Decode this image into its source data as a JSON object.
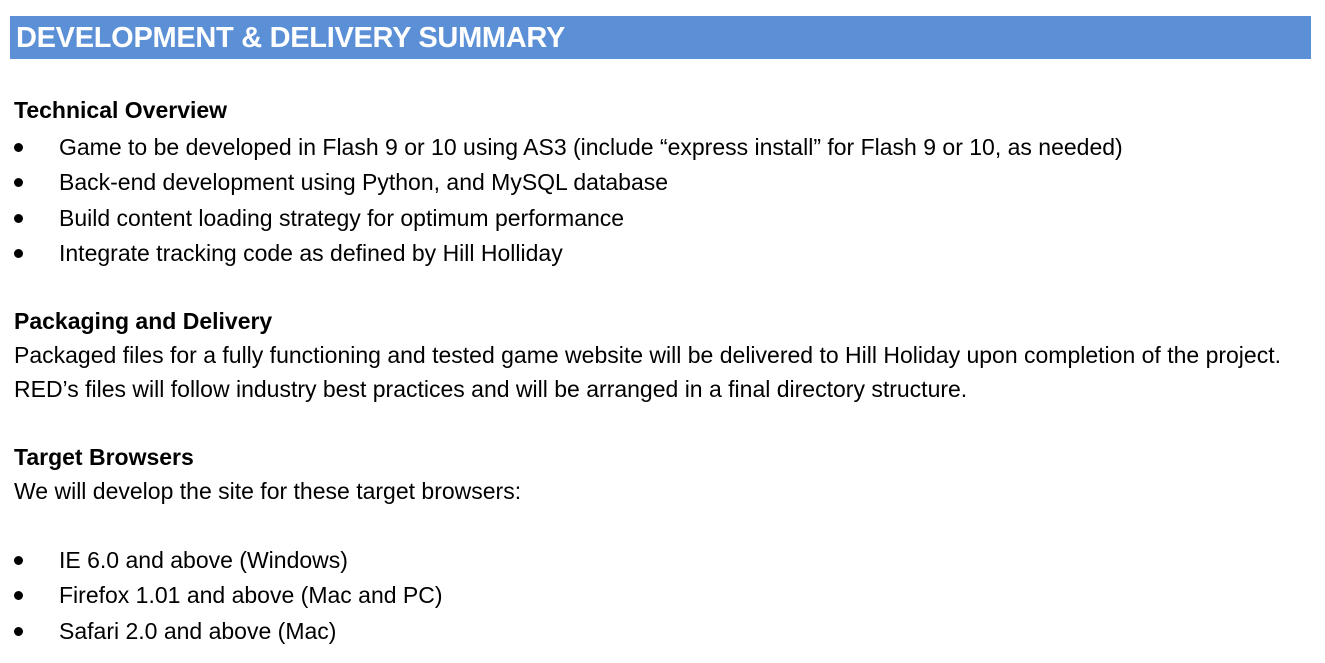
{
  "header": {
    "title": "DEVELOPMENT & DELIVERY SUMMARY",
    "bar_color": "#5b8fd6"
  },
  "technical_overview": {
    "heading": "Technical Overview",
    "items": [
      "Game to be developed in Flash 9 or 10 using AS3 (include “express install” for Flash 9 or 10, as needed)",
      "Back-end development using Python, and MySQL database",
      "Build content loading strategy for optimum performance",
      "Integrate tracking code as defined by Hill Holliday"
    ]
  },
  "packaging": {
    "heading": "Packaging and Delivery",
    "body": "Packaged files for a fully functioning and tested game website will be delivered to Hill Holiday upon completion of the project. RED’s files will follow industry best practices and will be arranged in a final directory structure."
  },
  "target_browsers": {
    "heading": "Target Browsers",
    "intro": "We will develop the site for these target browsers:",
    "items": [
      "IE 6.0 and above (Windows)",
      "Firefox 1.01 and above (Mac and PC)",
      "Safari 2.0 and above (Mac)"
    ]
  }
}
